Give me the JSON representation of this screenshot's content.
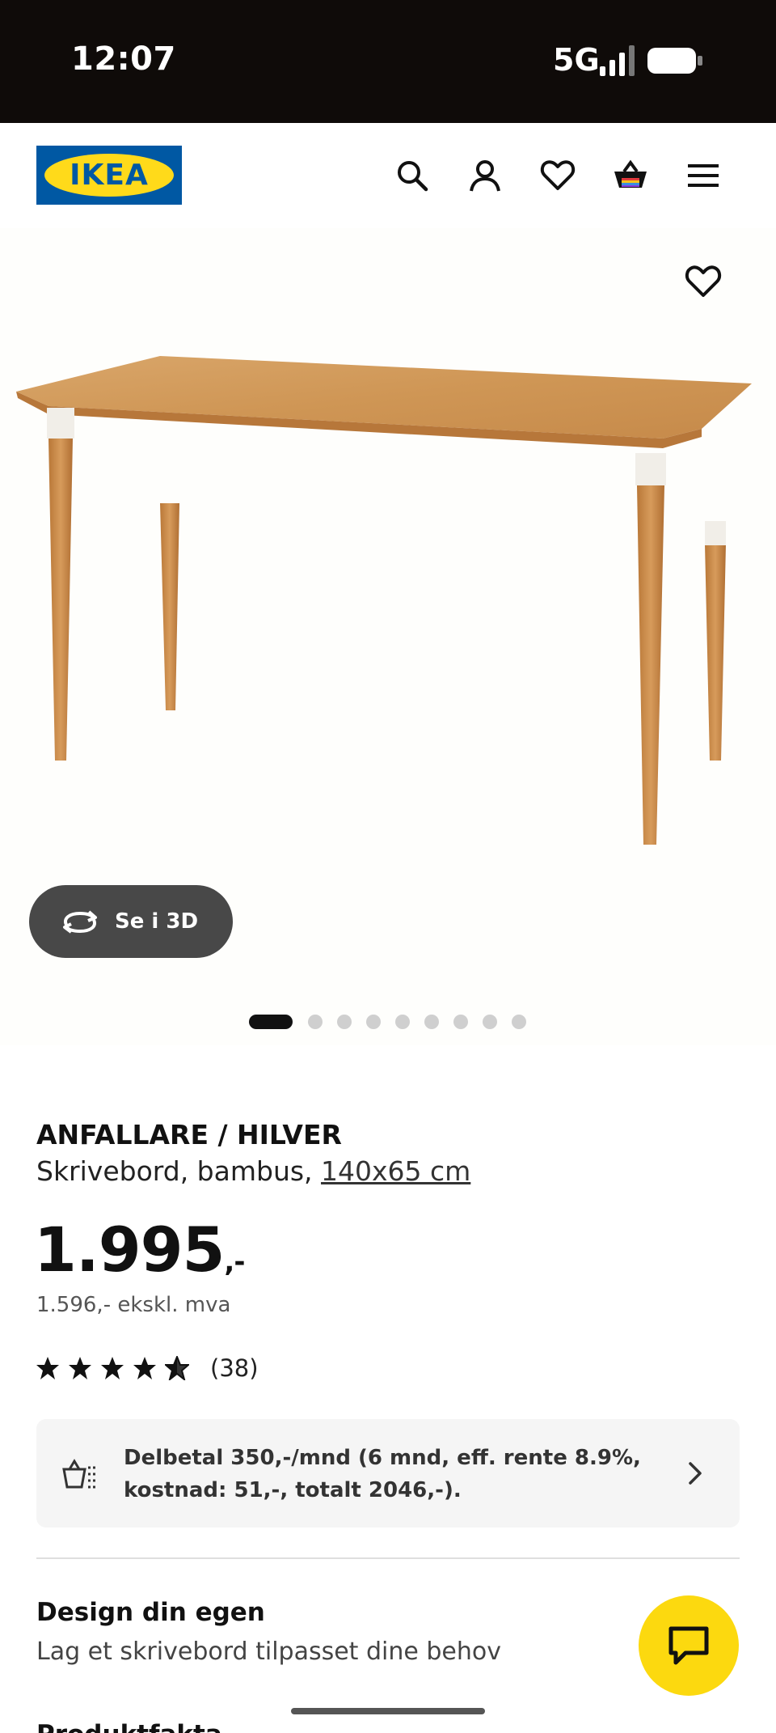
{
  "status_bar": {
    "time": "12:07",
    "network": "5G"
  },
  "header": {
    "logo_text": "IKEA"
  },
  "gallery": {
    "button_3d_label": "Se i 3D",
    "image_count": 9,
    "active_index": 0
  },
  "product": {
    "name": "ANFALLARE / HILVER",
    "description_prefix": "Skrivebord, bambus, ",
    "size": "140x65 cm",
    "price_main": "1.995",
    "price_suffix": ",-",
    "price_excl_vat": "1.596,- ekskl. mva",
    "rating_value": 4.5,
    "rating_count": "(38)"
  },
  "finance": {
    "text": "Delbetal 350,-/mnd (6 mnd, eff. rente 8.9%, kostnad: 51,-, totalt 2046,-)."
  },
  "design_section": {
    "title": "Design din egen",
    "subtitle": "Lag et skrivebord tilpasset dine behov"
  },
  "next_section_peek": "Produktfakta",
  "colors": {
    "ikea_blue": "#0058a3",
    "ikea_yellow": "#ffda1a",
    "chat_yellow": "#fcd90f",
    "status_bar_bg": "#0f0b09"
  }
}
